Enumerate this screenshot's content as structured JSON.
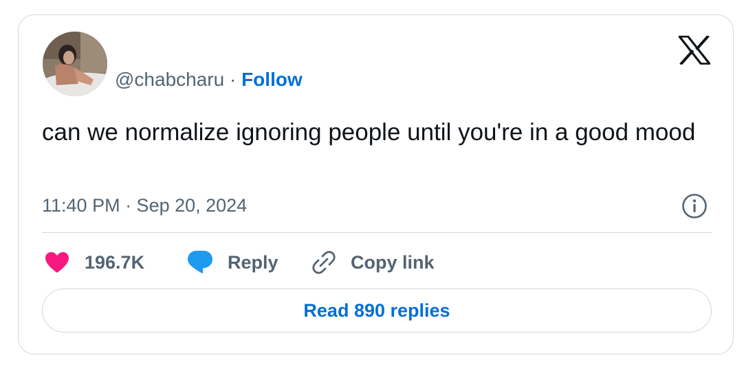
{
  "tweet": {
    "handle": "@chabcharu",
    "separator": " · ",
    "follow_label": "Follow",
    "text": "can we normalize ignoring people until you're in a good mood",
    "timestamp": "11:40 PM · Sep 20, 2024"
  },
  "actions": {
    "like_count": "196.7K",
    "reply_label": "Reply",
    "copy_link_label": "Copy link"
  },
  "read_replies_label": "Read 890 replies",
  "icons": {
    "brand": "x-logo-icon",
    "info": "info-icon",
    "like": "heart-icon",
    "reply": "speech-bubble-icon",
    "copy": "link-icon"
  },
  "colors": {
    "like": "#f91880",
    "reply": "#1d9bf0",
    "link_blue": "#006fd6",
    "secondary_text": "#536471",
    "border": "#cfd9de"
  }
}
